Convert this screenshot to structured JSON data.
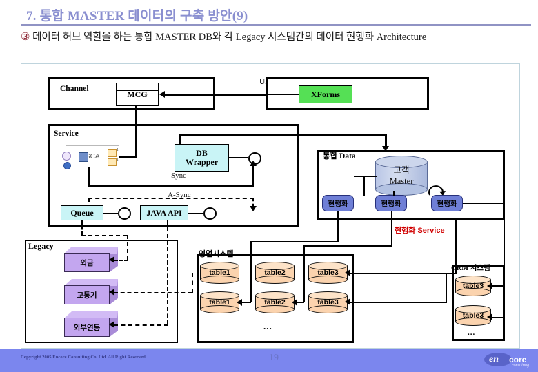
{
  "slide": {
    "title": "7. 통합 MASTER 데이터의 구축 방안(9)",
    "subhead_marker": "③",
    "subhead": "데이터 허브 역할을 하는 통합 MASTER DB와 각 Legacy 시스템간의 데이터 현행화 Architecture"
  },
  "diagram": {
    "channel": {
      "label": "Channel",
      "mcg": "MCG"
    },
    "ui": {
      "label": "UI",
      "xforms": "XForms"
    },
    "service": {
      "label": "Service",
      "sca": "SCA",
      "db_wrapper": "DB\nWrapper",
      "db_wrapper_line1": "DB",
      "db_wrapper_line2": "Wrapper",
      "sync": "Sync",
      "async": "A-Sync",
      "queue": "Queue",
      "java_api": "JAVA API"
    },
    "integrated_data": {
      "label": "통합 Data",
      "master_line1": "고객",
      "master_line2": "Master",
      "sync_boxes": [
        "현행화",
        "현행화",
        "현행화"
      ],
      "service_label": "현행화 Service"
    },
    "legacy": {
      "label": "Legacy",
      "items": [
        "외금",
        "교통기",
        "외부연동"
      ]
    },
    "sales_system": {
      "label": "영업시스템",
      "rows": [
        [
          "table1",
          "table2",
          "table3"
        ],
        [
          "table1",
          "table2",
          "table3"
        ]
      ],
      "more": "..."
    },
    "crm_system": {
      "label": "CRM 시스템",
      "tables": [
        "table3",
        "table3"
      ],
      "more": "..."
    }
  },
  "footer": {
    "copyright": "Copyright 2005 Encore Consulting Co. Ltd. All Right Reserved.",
    "page": "19",
    "logo_en": "en",
    "logo_core": "core",
    "logo_consulting": "consulting"
  },
  "colors": {
    "title": "#8a8fd0",
    "rule": "#9093c4",
    "marker": "#8a2230",
    "cyan_node": "#c9f4f6",
    "green_node": "#55e055",
    "sync_box": "#6f7fd6",
    "legacy_cube": "#c3a6ef",
    "table_cyl": "#fbd3ae",
    "red_label": "#d00000",
    "footer_bar": "#7b86ee"
  }
}
